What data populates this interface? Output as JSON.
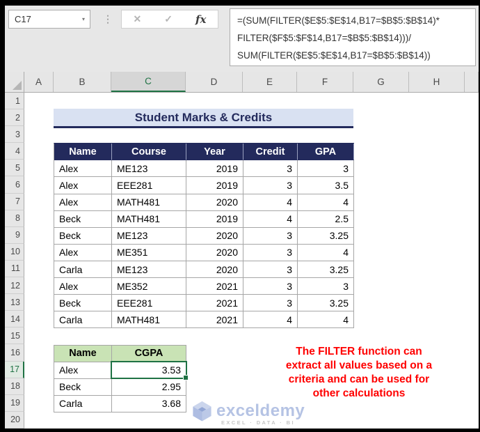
{
  "name_box": {
    "value": "C17"
  },
  "toolbar": {
    "dropdown_icon": "▾",
    "dots_icon": "⋮",
    "cancel_icon": "✕",
    "enter_icon": "✓",
    "fx_icon": "fx"
  },
  "formula_bar": {
    "lines": [
      "=(SUM(FILTER($E$5:$E$14,B17=$B$5:$B$14)*",
      "FILTER($F$5:$F$14,B17=$B$5:$B$14)))/",
      "SUM(FILTER($E$5:$E$14,B17=$B$5:$B$14))"
    ]
  },
  "grid": {
    "column_headers": [
      "A",
      "B",
      "C",
      "D",
      "E",
      "F",
      "G",
      "H"
    ],
    "row_headers": [
      "1",
      "2",
      "3",
      "4",
      "5",
      "6",
      "7",
      "8",
      "9",
      "10",
      "11",
      "12",
      "13",
      "14",
      "15",
      "16",
      "17",
      "18",
      "19",
      "20"
    ],
    "selected_column": "C",
    "selected_row": "17",
    "selected_cell": "C17"
  },
  "title_banner": {
    "text": "Student Marks & Credits"
  },
  "marks_table": {
    "headers": [
      "Name",
      "Course",
      "Year",
      "Credit",
      "GPA"
    ],
    "rows": [
      [
        "Alex",
        "ME123",
        "2019",
        "3",
        "3"
      ],
      [
        "Alex",
        "EEE281",
        "2019",
        "3",
        "3.5"
      ],
      [
        "Alex",
        "MATH481",
        "2020",
        "4",
        "4"
      ],
      [
        "Beck",
        "MATH481",
        "2019",
        "4",
        "2.5"
      ],
      [
        "Beck",
        "ME123",
        "2020",
        "3",
        "3.25"
      ],
      [
        "Alex",
        "ME351",
        "2020",
        "3",
        "4"
      ],
      [
        "Carla",
        "ME123",
        "2020",
        "3",
        "3.25"
      ],
      [
        "Alex",
        "ME352",
        "2021",
        "3",
        "3"
      ],
      [
        "Beck",
        "EEE281",
        "2021",
        "3",
        "3.25"
      ],
      [
        "Carla",
        "MATH481",
        "2021",
        "4",
        "4"
      ]
    ]
  },
  "cgpa_table": {
    "headers": [
      "Name",
      "CGPA"
    ],
    "rows": [
      [
        "Alex",
        "3.53"
      ],
      [
        "Beck",
        "2.95"
      ],
      [
        "Carla",
        "3.68"
      ]
    ],
    "selected_value": "3.53"
  },
  "annotation": {
    "lines": [
      "The FILTER function can",
      "extract all values based on a",
      "criteria and can be used for",
      "other calculations"
    ]
  },
  "watermark": {
    "brand": "exceldemy",
    "tagline": "EXCEL · DATA · BI"
  },
  "colors": {
    "selection_green": "#1F7244",
    "table_header_navy": "#232A5C",
    "title_bg": "#D9E1F2",
    "cgpa_header_green": "#C9E3B5",
    "annotation_red": "#FF0000",
    "watermark_blue": "#B5C3E4"
  }
}
